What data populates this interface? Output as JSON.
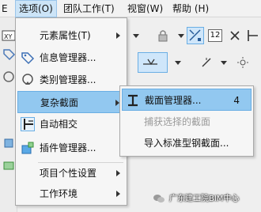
{
  "menubar": {
    "items": [
      {
        "label": "选项(O)"
      },
      {
        "label": "团队工作(T)"
      },
      {
        "label": "视窗(W)"
      },
      {
        "label": "帮助 (H)"
      }
    ]
  },
  "options_menu": {
    "items": [
      {
        "label": "元素属性(T)",
        "icon": "element-properties-icon"
      },
      {
        "label": "信息管理器...",
        "icon": "tag-icon"
      },
      {
        "label": "类别管理器...",
        "icon": "category-icon"
      },
      {
        "label": "复杂截面",
        "icon": ""
      },
      {
        "label": "自动相交",
        "icon": "auto-intersect-icon"
      },
      {
        "label": "插件管理器...",
        "icon": "plugin-icon"
      },
      {
        "label": "项目个性设置",
        "icon": ""
      },
      {
        "label": "工作环境",
        "icon": ""
      }
    ]
  },
  "complex_profile_submenu": {
    "items": [
      {
        "label": "截面管理器...",
        "shortcut": "4",
        "icon": "i-beam-icon"
      },
      {
        "label": "捕获选择的截面",
        "shortcut": "",
        "icon": ""
      },
      {
        "label": "导入标准型钢截面...",
        "shortcut": "",
        "icon": ""
      }
    ]
  },
  "toolbar": {
    "dim_label": "12"
  },
  "watermark": {
    "text": "广东建工院BIM中心"
  },
  "colors": {
    "highlight": "#92c8f0",
    "menubar_active": "#cce4f7"
  }
}
